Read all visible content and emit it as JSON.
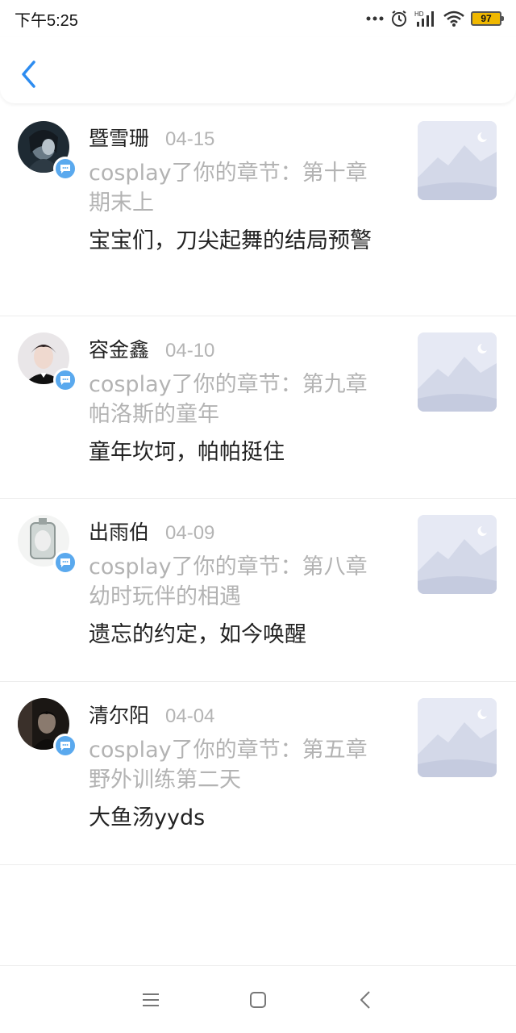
{
  "status_bar": {
    "time": "下午5:25",
    "battery": "97",
    "network_label": "HD",
    "icons": [
      "more-dots-icon",
      "alarm-icon",
      "signal-icon",
      "wifi-icon",
      "battery-icon"
    ]
  },
  "header": {
    "back_icon": "chevron-left-icon",
    "accent": "#2d8cf0"
  },
  "notifications": [
    {
      "name": "暨雪珊",
      "date": "04-15",
      "action": "cosplay了你的章节：第十章期末上",
      "comment": "宝宝们，刀尖起舞的结局预警"
    },
    {
      "name": "容金鑫",
      "date": "04-10",
      "action": "cosplay了你的章节：第九章帕洛斯的童年",
      "comment": "童年坎坷，帕帕挺住"
    },
    {
      "name": "出雨伯",
      "date": "04-09",
      "action": "cosplay了你的章节：第八章幼时玩伴的相遇",
      "comment": "遗忘的约定，如今唤醒"
    },
    {
      "name": "清尔阳",
      "date": "04-04",
      "action": "cosplay了你的章节：第五章野外训练第二天",
      "comment": "大鱼汤yyds"
    }
  ],
  "nav_bar": {
    "icons": [
      "menu-icon",
      "home-square-icon",
      "back-triangle-icon"
    ]
  },
  "colors": {
    "badge": "#5aa9ee",
    "muted_text": "#b3b3b3",
    "battery": "#f0b800"
  }
}
